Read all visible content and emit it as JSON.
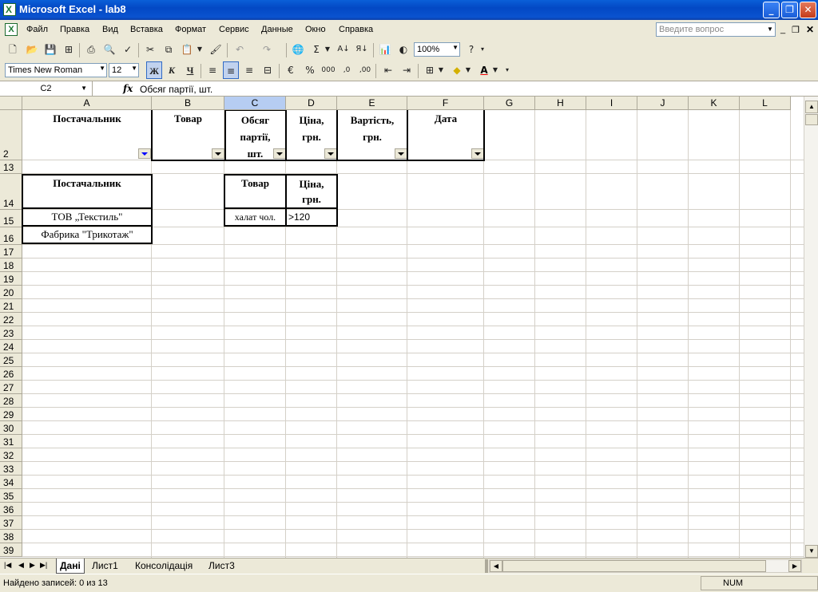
{
  "window": {
    "title": "Microsoft Excel - lab8"
  },
  "menu": [
    "Файл",
    "Правка",
    "Вид",
    "Вставка",
    "Формат",
    "Сервис",
    "Данные",
    "Окно",
    "Справка"
  ],
  "question_placeholder": "Введите вопрос",
  "toolbar": {
    "zoom": "100%"
  },
  "format_toolbar": {
    "font": "Times New Roman",
    "size": "12",
    "bold": "Ж",
    "italic": "К",
    "underline": "Ч"
  },
  "formula_bar": {
    "cell_ref": "C2",
    "fx": "fx",
    "content": "Обсяг партії, шт."
  },
  "columns": [
    "A",
    "B",
    "C",
    "D",
    "E",
    "F",
    "G",
    "H",
    "I",
    "J",
    "K",
    "L"
  ],
  "rows": [
    "2",
    "13",
    "14",
    "15",
    "16",
    "17",
    "18",
    "19",
    "20",
    "21",
    "22",
    "23",
    "24",
    "25",
    "26",
    "27",
    "28",
    "29",
    "30",
    "31",
    "32",
    "33",
    "34",
    "35",
    "36",
    "37",
    "38",
    "39"
  ],
  "header_row": {
    "a": "Постачальник",
    "b": "Товар",
    "c": [
      "Обсяг",
      "партії,",
      "шт."
    ],
    "d": [
      "Ціна,",
      "грн."
    ],
    "e": [
      "Вартість,",
      "грн."
    ],
    "f": "Дата"
  },
  "criteria1": {
    "header": "Постачальник",
    "rows": [
      "ТОВ „Текстиль\"",
      "Фабрика \"Трикотаж\""
    ]
  },
  "criteria2": {
    "header_c": "Товар",
    "header_d": [
      "Ціна,",
      "грн."
    ],
    "value_c": "халат чол.",
    "value_d": ">120"
  },
  "sheets": [
    "Дані",
    "Лист1",
    "Консолідація",
    "Лист3"
  ],
  "status": {
    "text": "Найдено записей: 0 из 13",
    "num": "NUM"
  }
}
